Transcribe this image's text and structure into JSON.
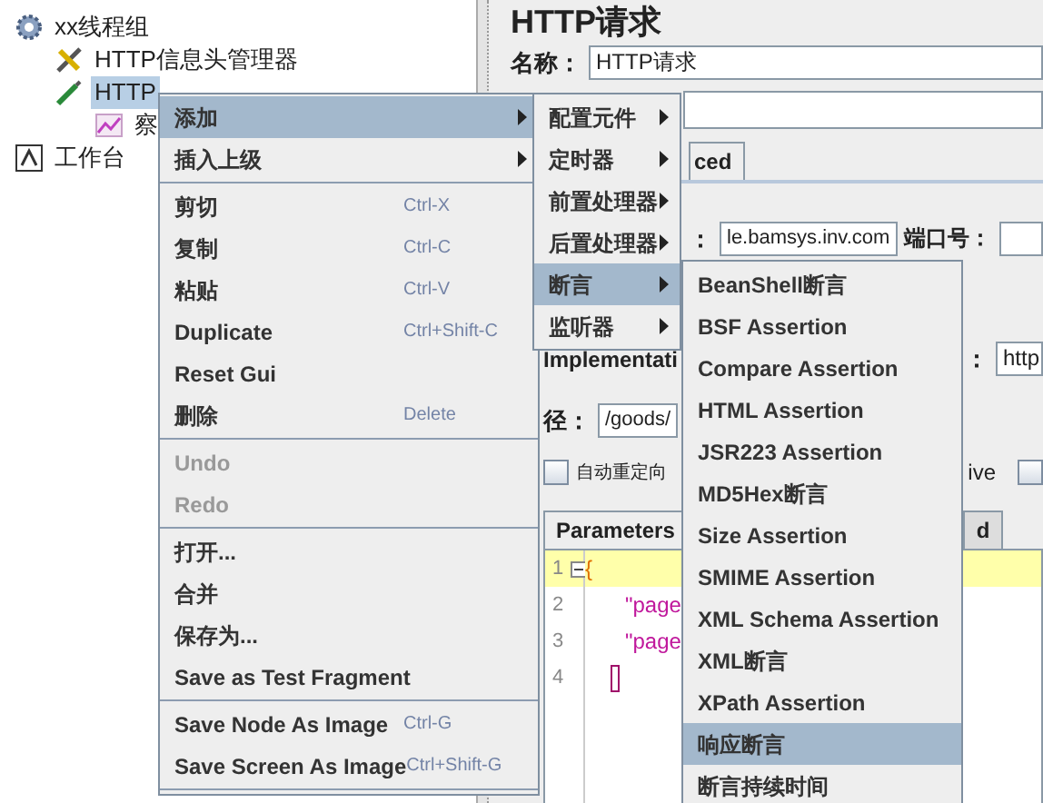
{
  "tree": [
    {
      "label": "xx线程组",
      "kind": "thread-group",
      "selected": false,
      "children": [
        {
          "label": "HTTP信息头管理器",
          "kind": "header-manager",
          "selected": false
        },
        {
          "label": "HTTP",
          "kind": "sampler",
          "selected": true,
          "children": [
            {
              "label": "察",
              "kind": "listener",
              "selected": false
            }
          ]
        }
      ]
    },
    {
      "label": "工作台",
      "kind": "workbench",
      "selected": false
    }
  ],
  "panel": {
    "title": "HTTP请求",
    "name_label": "名称：",
    "name_value": "HTTP请求",
    "tab": "ced",
    "server_label": "：",
    "server_value": "le.bamsys.inv.com",
    "port_label": "端口号：",
    "impl_label": "Implementati",
    "impl_colon": "：",
    "protocol_value": "http",
    "path_label": "径：",
    "path_value": "/goods/",
    "redirect": {
      "label": "自动重定向",
      "checked": false
    },
    "keepalive_text": "ive",
    "keepalive_checked": false,
    "tabs": [
      {
        "label": "Parameters",
        "selected": true
      },
      {
        "label": "d",
        "selected": false
      }
    ],
    "editor": [
      {
        "number": "1",
        "text": "{",
        "kind": "brace",
        "fold": true,
        "highlighted": true
      },
      {
        "number": "2",
        "text": "\"page",
        "kind": "string",
        "fold": false,
        "highlighted": false
      },
      {
        "number": "3",
        "text": "\"page",
        "kind": "string",
        "fold": false,
        "highlighted": false
      },
      {
        "number": "4",
        "kind": "cursor",
        "fold": false,
        "highlighted": false
      }
    ]
  },
  "context_menu": [
    {
      "kind": "item",
      "label": "添加",
      "submenu": true,
      "selected": true,
      "disabled": false
    },
    {
      "kind": "item",
      "label": "插入上级",
      "submenu": true,
      "selected": false,
      "disabled": false
    },
    {
      "kind": "separator"
    },
    {
      "kind": "item",
      "label": "剪切",
      "shortcut": "Ctrl-X",
      "selected": false,
      "disabled": false
    },
    {
      "kind": "item",
      "label": "复制",
      "shortcut": "Ctrl-C",
      "selected": false,
      "disabled": false
    },
    {
      "kind": "item",
      "label": "粘贴",
      "shortcut": "Ctrl-V",
      "selected": false,
      "disabled": false
    },
    {
      "kind": "item",
      "label": "Duplicate",
      "shortcut": "Ctrl+Shift-C",
      "selected": false,
      "disabled": false
    },
    {
      "kind": "item",
      "label": "Reset Gui",
      "selected": false,
      "disabled": false
    },
    {
      "kind": "item",
      "label": "删除",
      "shortcut": "Delete",
      "selected": false,
      "disabled": false
    },
    {
      "kind": "separator"
    },
    {
      "kind": "item",
      "label": "Undo",
      "selected": false,
      "disabled": true
    },
    {
      "kind": "item",
      "label": "Redo",
      "selected": false,
      "disabled": true
    },
    {
      "kind": "separator"
    },
    {
      "kind": "item",
      "label": "打开...",
      "selected": false,
      "disabled": false
    },
    {
      "kind": "item",
      "label": "合并",
      "selected": false,
      "disabled": false
    },
    {
      "kind": "item",
      "label": "保存为...",
      "selected": false,
      "disabled": false
    },
    {
      "kind": "item",
      "label": "Save as Test Fragment",
      "selected": false,
      "disabled": false
    },
    {
      "kind": "separator"
    },
    {
      "kind": "item",
      "label": "Save Node As Image",
      "shortcut": "Ctrl-G",
      "selected": false,
      "disabled": false
    },
    {
      "kind": "item",
      "label": "Save Screen As Image",
      "shortcut": "Ctrl+Shift-G",
      "selected": false,
      "disabled": false
    },
    {
      "kind": "separator"
    }
  ],
  "add_submenu": [
    {
      "kind": "item",
      "label": "配置元件",
      "submenu": true,
      "selected": false,
      "disabled": false
    },
    {
      "kind": "item",
      "label": "定时器",
      "submenu": true,
      "selected": false,
      "disabled": false
    },
    {
      "kind": "item",
      "label": "前置处理器",
      "submenu": true,
      "selected": false,
      "disabled": false
    },
    {
      "kind": "item",
      "label": "后置处理器",
      "submenu": true,
      "selected": false,
      "disabled": false
    },
    {
      "kind": "item",
      "label": "断言",
      "submenu": true,
      "selected": true,
      "disabled": false
    },
    {
      "kind": "item",
      "label": "监听器",
      "submenu": true,
      "selected": false,
      "disabled": false
    }
  ],
  "assertion_submenu": [
    {
      "kind": "item",
      "label": "BeanShell断言",
      "selected": false,
      "disabled": false
    },
    {
      "kind": "item",
      "label": "BSF Assertion",
      "selected": false,
      "disabled": false
    },
    {
      "kind": "item",
      "label": "Compare Assertion",
      "selected": false,
      "disabled": false
    },
    {
      "kind": "item",
      "label": "HTML Assertion",
      "selected": false,
      "disabled": false
    },
    {
      "kind": "item",
      "label": "JSR223 Assertion",
      "selected": false,
      "disabled": false
    },
    {
      "kind": "item",
      "label": "MD5Hex断言",
      "selected": false,
      "disabled": false
    },
    {
      "kind": "item",
      "label": "Size Assertion",
      "selected": false,
      "disabled": false
    },
    {
      "kind": "item",
      "label": "SMIME Assertion",
      "selected": false,
      "disabled": false
    },
    {
      "kind": "item",
      "label": "XML Schema Assertion",
      "selected": false,
      "disabled": false
    },
    {
      "kind": "item",
      "label": "XML断言",
      "selected": false,
      "disabled": false
    },
    {
      "kind": "item",
      "label": "XPath Assertion",
      "selected": false,
      "disabled": false
    },
    {
      "kind": "item",
      "label": "响应断言",
      "selected": true,
      "disabled": false
    },
    {
      "kind": "item",
      "label": "断言持续时间",
      "selected": false,
      "disabled": false
    }
  ]
}
